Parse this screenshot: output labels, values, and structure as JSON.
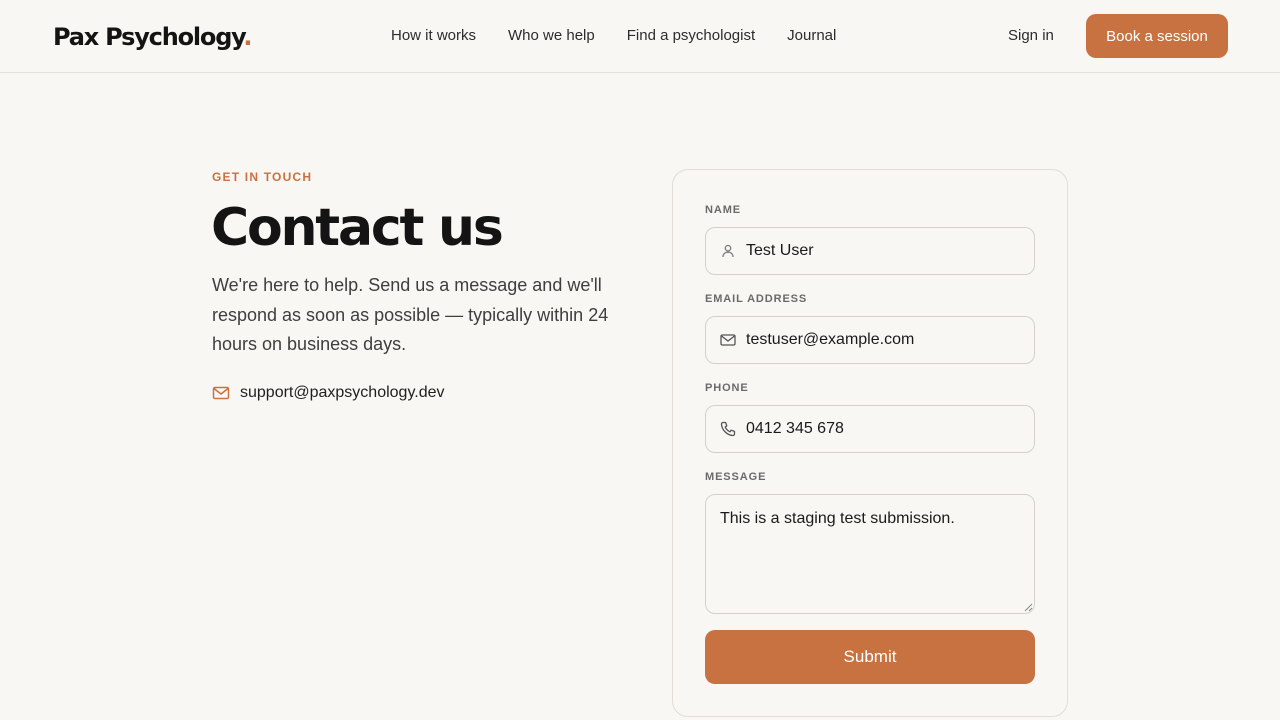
{
  "header": {
    "logo_text": "Pax Psychology",
    "logo_dot": ".",
    "nav": [
      "How it works",
      "Who we help",
      "Find a psychologist",
      "Journal"
    ],
    "sign_in": "Sign in",
    "book_button": "Book a session"
  },
  "hero": {
    "eyebrow": "GET IN TOUCH",
    "title": "Contact us",
    "lede": "We're here to help. Send us a message and we'll respond as soon as possible — typically within 24 hours on business days.",
    "support_email": "support@paxpsychology.dev",
    "support_icon": "mail-icon"
  },
  "form": {
    "name_label": "NAME",
    "name_value": "Test User",
    "name_icon": "user-icon",
    "email_label": "EMAIL ADDRESS",
    "email_value": "testuser@example.com",
    "email_icon": "mail-icon",
    "phone_label": "PHONE",
    "phone_value": "0412 345 678",
    "phone_icon": "phone-icon",
    "message_label": "MESSAGE",
    "message_value": "This is a staging test submission.",
    "submit_label": "Submit"
  },
  "colors": {
    "accent": "#c87241",
    "background": "#f9f7f3",
    "border": "#d5d1ca"
  }
}
